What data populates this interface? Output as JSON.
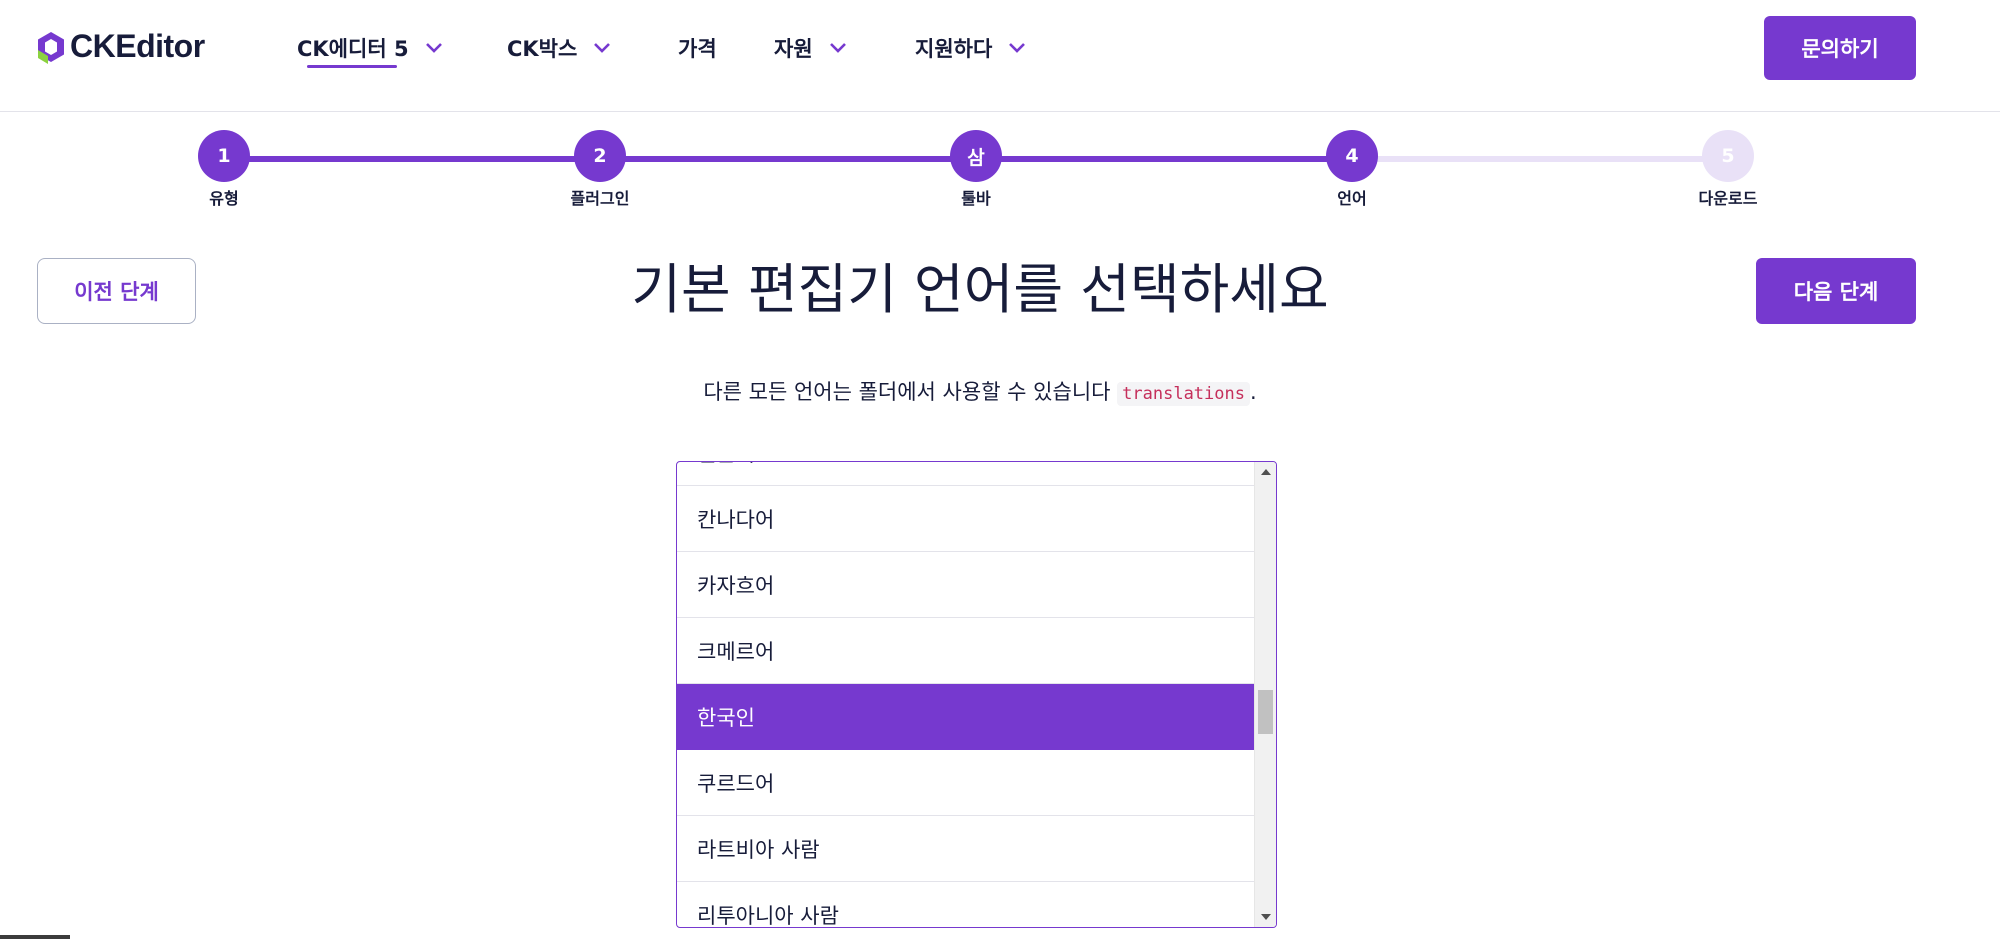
{
  "header": {
    "logo_text": "CKEditor",
    "nav": [
      {
        "label": "CK에디터 5",
        "has_dropdown": true,
        "active": true
      },
      {
        "label": "CK박스",
        "has_dropdown": true
      },
      {
        "label": "가격",
        "has_dropdown": false
      },
      {
        "label": "자원",
        "has_dropdown": true
      },
      {
        "label": "지원하다",
        "has_dropdown": true
      }
    ],
    "contact_label": "문의하기"
  },
  "stepper": {
    "steps": [
      {
        "number": "1",
        "label": "유형",
        "state": "complete"
      },
      {
        "number": "2",
        "label": "플러그인",
        "state": "complete"
      },
      {
        "number": "삼",
        "label": "툴바",
        "state": "complete"
      },
      {
        "number": "4",
        "label": "언어",
        "state": "current"
      },
      {
        "number": "5",
        "label": "다운로드",
        "state": "pending"
      }
    ]
  },
  "main": {
    "prev_label": "이전 단계",
    "next_label": "다음 단계",
    "title": "기본 편집기 언어를 선택하세요",
    "subtitle_before": "다른 모든 언어는 폴더에서 사용할 수 있습니다",
    "subtitle_code": "translations",
    "subtitle_after": "."
  },
  "language_list": {
    "options": [
      "일본어",
      "칸나다어",
      "카자흐어",
      "크메르어",
      "한국인",
      "쿠르드어",
      "라트비아 사람",
      "리투아니아 사람"
    ],
    "selected": "한국인"
  },
  "colors": {
    "accent": "#7639cf",
    "accent_light": "#e9e1f7",
    "text": "#171c3a",
    "code_text": "#c52f5b"
  }
}
